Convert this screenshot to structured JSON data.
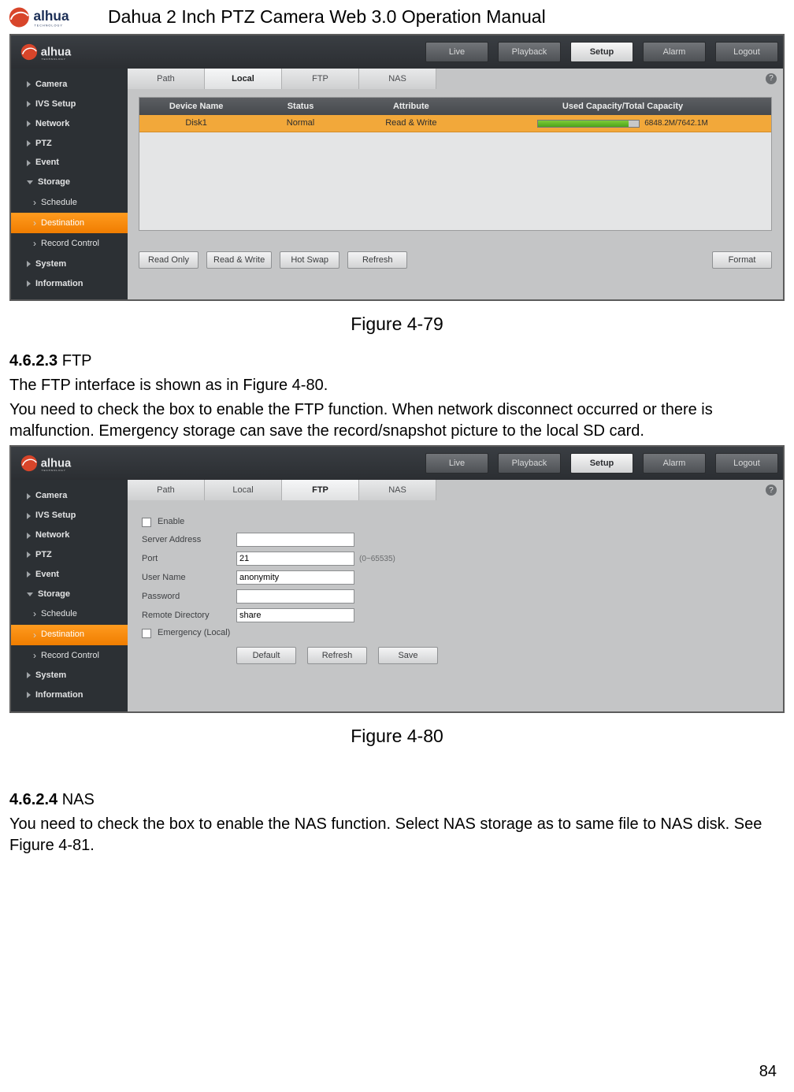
{
  "doc": {
    "title": "Dahua 2 Inch PTZ Camera Web 3.0 Operation Manual",
    "page_num": "84"
  },
  "figures": {
    "f79": "Figure 4-79",
    "f80": "Figure 4-80"
  },
  "sections": {
    "ftp": {
      "num": "4.6.2.3",
      "title": "FTP",
      "p1": "The FTP interface is shown as in Figure 4-80.",
      "p2": "You need to check the box to enable the FTP function. When network disconnect occurred or there is malfunction. Emergency storage can save the record/snapshot picture to the local SD card."
    },
    "nas": {
      "num": "4.6.2.4",
      "title": "NAS",
      "p1": "You need to check the box to enable the NAS function. Select NAS storage as to same file to NAS disk. See Figure 4-81."
    }
  },
  "top_tabs": {
    "live": "Live",
    "playback": "Playback",
    "setup": "Setup",
    "alarm": "Alarm",
    "logout": "Logout"
  },
  "sidebar": {
    "camera": "Camera",
    "ivs": "IVS Setup",
    "network": "Network",
    "ptz": "PTZ",
    "event": "Event",
    "storage": "Storage",
    "schedule": "Schedule",
    "destination": "Destination",
    "record_control": "Record Control",
    "system": "System",
    "information": "Information"
  },
  "tabs": {
    "path": "Path",
    "local": "Local",
    "ftp": "FTP",
    "nas": "NAS"
  },
  "local": {
    "head_device": "Device Name",
    "head_status": "Status",
    "head_attr": "Attribute",
    "head_cap": "Used Capacity/Total Capacity",
    "row": {
      "device": "Disk1",
      "status": "Normal",
      "attr": "Read & Write",
      "cap": "6848.2M/7642.1M"
    },
    "btn_ro": "Read Only",
    "btn_rw": "Read & Write",
    "btn_hotswap": "Hot Swap",
    "btn_refresh": "Refresh",
    "btn_format": "Format"
  },
  "ftp": {
    "enable": "Enable",
    "server_addr": "Server Address",
    "port": "Port",
    "port_val": "21",
    "port_hint": "(0~65535)",
    "user": "User Name",
    "user_val": "anonymity",
    "pass": "Password",
    "remote_dir": "Remote Directory",
    "remote_dir_val": "share",
    "emergency": "Emergency (Local)",
    "btn_default": "Default",
    "btn_refresh": "Refresh",
    "btn_save": "Save"
  },
  "help": "?"
}
